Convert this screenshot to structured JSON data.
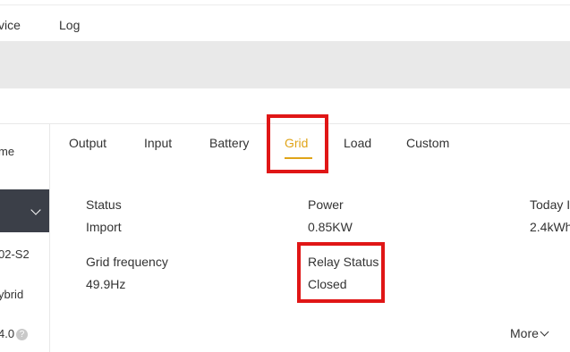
{
  "topnav": {
    "items": [
      "vice",
      "Log"
    ]
  },
  "sidebar": {
    "items": [
      "me",
      "02-S2",
      "ybrid",
      "4.0"
    ],
    "help_icon": "help-circle-icon"
  },
  "tabs": [
    "Output",
    "Input",
    "Battery",
    "Grid",
    "Load",
    "Custom"
  ],
  "active_tab": "Grid",
  "grid": {
    "status": {
      "label": "Status",
      "value": "Import"
    },
    "power": {
      "label": "Power",
      "value": "0.85KW"
    },
    "today": {
      "label": "Today I",
      "value": "2.4kWh"
    },
    "frequency": {
      "label": "Grid frequency",
      "value": "49.9Hz"
    },
    "relay": {
      "label": "Relay Status",
      "value": "Closed"
    }
  },
  "more_label": "More",
  "colors": {
    "accent": "#e0a419",
    "highlight": "#e01616",
    "sidebar_dark": "#3b3f48",
    "gray_bar": "#e9e9e9"
  }
}
